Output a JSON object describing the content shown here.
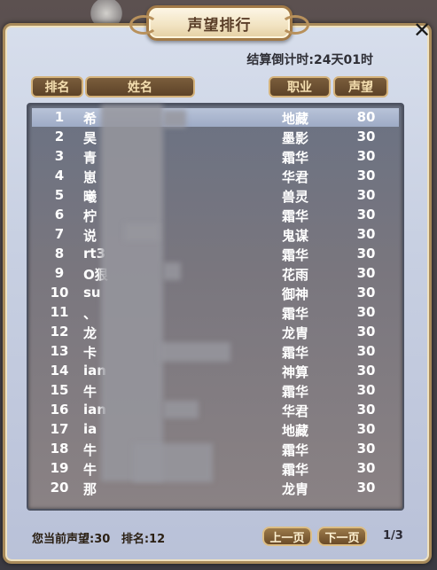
{
  "title": "声望排行",
  "countdown": "结算倒计时:24天01时",
  "headers": {
    "rank": "排名",
    "name": "姓名",
    "job": "职业",
    "reputation": "声望"
  },
  "rows": [
    {
      "rank": "1",
      "name": "希",
      "job": "地藏",
      "rep": "80"
    },
    {
      "rank": "2",
      "name": "昊",
      "job": "墨影",
      "rep": "30"
    },
    {
      "rank": "3",
      "name": "青",
      "job": "霜华",
      "rep": "30"
    },
    {
      "rank": "4",
      "name": "崽",
      "job": "华君",
      "rep": "30"
    },
    {
      "rank": "5",
      "name": "曦",
      "job": "兽灵",
      "rep": "30"
    },
    {
      "rank": "6",
      "name": "柠",
      "job": "霜华",
      "rep": "30"
    },
    {
      "rank": "7",
      "name": "说",
      "job": "鬼谋",
      "rep": "30"
    },
    {
      "rank": "8",
      "name": "rt3",
      "job": "霜华",
      "rep": "30"
    },
    {
      "rank": "9",
      "name": "O狠",
      "job": "花雨",
      "rep": "30"
    },
    {
      "rank": "10",
      "name": "su",
      "job": "御神",
      "rep": "30"
    },
    {
      "rank": "11",
      "name": "、",
      "job": "霜华",
      "rep": "30"
    },
    {
      "rank": "12",
      "name": "龙",
      "job": "龙胄",
      "rep": "30"
    },
    {
      "rank": "13",
      "name": "卡",
      "job": "霜华",
      "rep": "30"
    },
    {
      "rank": "14",
      "name": "ian",
      "job": "神算",
      "rep": "30"
    },
    {
      "rank": "15",
      "name": "牛",
      "job": "霜华",
      "rep": "30"
    },
    {
      "rank": "16",
      "name": "ian",
      "job": "华君",
      "rep": "30"
    },
    {
      "rank": "17",
      "name": "ia",
      "job": "地藏",
      "rep": "30"
    },
    {
      "rank": "18",
      "name": "牛",
      "job": "霜华",
      "rep": "30"
    },
    {
      "rank": "19",
      "name": "牛",
      "job": "霜华",
      "rep": "30"
    },
    {
      "rank": "20",
      "name": "那",
      "job": "龙胄",
      "rep": "30"
    }
  ],
  "footer": {
    "current_rep": "您当前声望:30",
    "current_rank": "排名:12",
    "prev_label": "上一页",
    "next_label": "下一页",
    "page": "1/3"
  },
  "close_icon": "close-icon"
}
